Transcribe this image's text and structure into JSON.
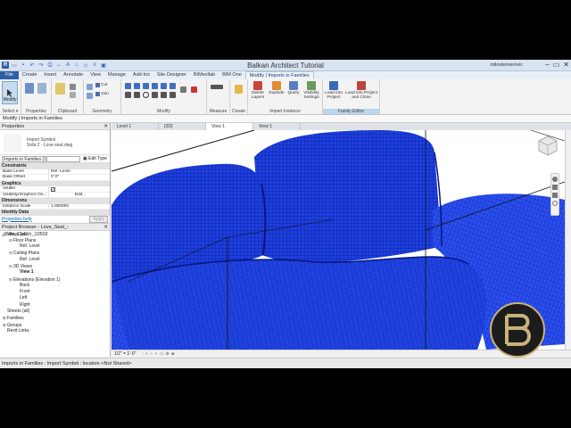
{
  "window": {
    "title": "Balkan Architect Tutorial",
    "user": "milostemerovic"
  },
  "ribbon_tabs": [
    "File",
    "Create",
    "Insert",
    "Annotate",
    "View",
    "Manage",
    "Add-Ins",
    "Site Designer",
    "BIMsollab",
    "BIM One",
    "Modify | Imports in Families"
  ],
  "ribbon": {
    "modify_label": "Modify",
    "panels": {
      "select": "Select ▾",
      "properties": "Properties",
      "clipboard": "Clipboard",
      "geometry": "Geometry",
      "modify": "Modify",
      "measure": "Measure",
      "create": "Create",
      "import_instance": "Import Instance",
      "family_editor": "Family Editor"
    },
    "buttons": {
      "cut": "Cut",
      "join": "Join",
      "delete_layers": "Delete Layers",
      "explode": "Explode",
      "query": "Query",
      "visibility_settings": "Visibility Settings",
      "load_into_project": "Load into Project",
      "load_into_project_close": "Load into Project and Close"
    }
  },
  "option_bar": "Modify | Imports in Families",
  "properties_panel": {
    "title": "Properties",
    "type_line1": "Import Symbol",
    "type_line2": "Sofa 2 - Love seat.dwg",
    "instance_selector": "Imports in Families (1)",
    "edit_type": "Edit Type",
    "sections": [
      {
        "name": "Constraints",
        "rows": [
          {
            "key": "Base Level",
            "value": "Ref. Level"
          },
          {
            "key": "Base Offset",
            "value": "0' 0\""
          }
        ]
      },
      {
        "name": "Graphics",
        "rows": [
          {
            "key": "Visible",
            "value": "✓"
          },
          {
            "key": "Visibility/Graphics Ov...",
            "value": "Edit..."
          }
        ]
      },
      {
        "name": "Dimensions",
        "rows": [
          {
            "key": "Instance Scale",
            "value": "1.000000"
          }
        ]
      },
      {
        "name": "Identity Data",
        "rows": []
      }
    ],
    "help_link": "Properties help",
    "apply": "Apply"
  },
  "project_browser": {
    "title": "Project Browser - Love_Seat_-_Sofa_Couch_10502",
    "items": [
      {
        "label": "Views (all)",
        "level": 0,
        "toggle": "−",
        "bold": false
      },
      {
        "label": "Floor Plans",
        "level": 1,
        "toggle": "−",
        "bold": false
      },
      {
        "label": "Ref. Level",
        "level": 2,
        "toggle": "",
        "bold": false
      },
      {
        "label": "Ceiling Plans",
        "level": 1,
        "toggle": "−",
        "bold": false
      },
      {
        "label": "Ref. Level",
        "level": 2,
        "toggle": "",
        "bold": false
      },
      {
        "label": "3D Views",
        "level": 1,
        "toggle": "−",
        "bold": false
      },
      {
        "label": "View 1",
        "level": 2,
        "toggle": "",
        "bold": true
      },
      {
        "label": "Elevations (Elevation 1)",
        "level": 1,
        "toggle": "−",
        "bold": false
      },
      {
        "label": "Back",
        "level": 2,
        "toggle": "",
        "bold": false
      },
      {
        "label": "Front",
        "level": 2,
        "toggle": "",
        "bold": false
      },
      {
        "label": "Left",
        "level": 2,
        "toggle": "",
        "bold": false
      },
      {
        "label": "Right",
        "level": 2,
        "toggle": "",
        "bold": false
      },
      {
        "label": "Sheets (all)",
        "level": 0,
        "toggle": "",
        "bold": false
      },
      {
        "label": "Families",
        "level": 0,
        "toggle": "+",
        "bold": false
      },
      {
        "label": "Groups",
        "level": 0,
        "toggle": "+",
        "bold": false
      },
      {
        "label": "Revit Links",
        "level": 0,
        "toggle": "",
        "bold": false
      }
    ]
  },
  "view_tabs": [
    {
      "label": "Level 1",
      "active": false
    },
    {
      "label": "{3D}",
      "active": false
    },
    {
      "label": "View 1",
      "active": true
    },
    {
      "label": "View 1",
      "active": false
    }
  ],
  "view_bar": "1/2\" = 1'-0\"",
  "status_bar": "Imports in Families : Import Symbol : location <Not Shared>",
  "colors": {
    "mesh": "#1e3fe0",
    "mesh_dark": "#0b1f9a",
    "file_tab": "#2d5fa5",
    "logo_ring": "#c9b27a"
  }
}
